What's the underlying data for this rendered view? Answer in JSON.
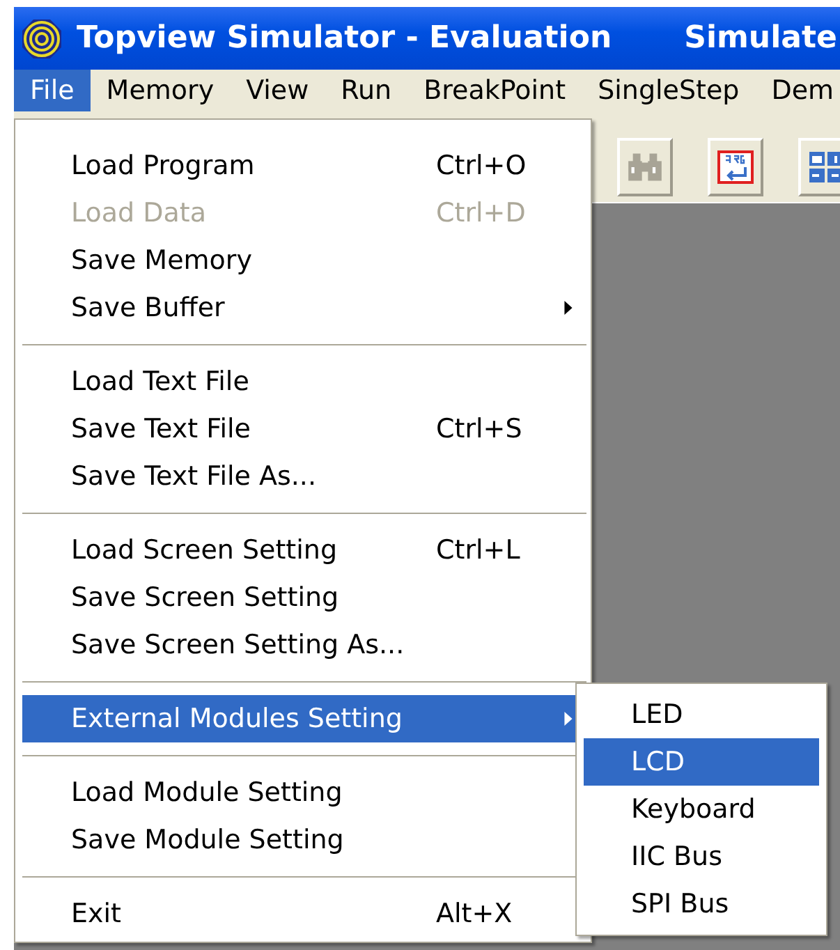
{
  "window": {
    "title": "Topview Simulator - Evaluation",
    "title_2": "Simulate"
  },
  "menubar": [
    {
      "label": "File",
      "selected": true
    },
    {
      "label": "Memory",
      "selected": false
    },
    {
      "label": "View",
      "selected": false
    },
    {
      "label": "Run",
      "selected": false
    },
    {
      "label": "BreakPoint",
      "selected": false
    },
    {
      "label": "SingleStep",
      "selected": false
    },
    {
      "label": "Dem",
      "selected": false
    }
  ],
  "toolbar": [
    {
      "kind": "find"
    },
    {
      "kind": "program"
    },
    {
      "kind": "layout"
    }
  ],
  "file_menu": [
    {
      "kind": "item",
      "label": "Load Program",
      "shortcut": "Ctrl+O",
      "disabled": false,
      "selected": false,
      "has_submenu": false
    },
    {
      "kind": "item",
      "label": "Load Data",
      "shortcut": "Ctrl+D",
      "disabled": true,
      "selected": false,
      "has_submenu": false
    },
    {
      "kind": "item",
      "label": "Save Memory",
      "disabled": false,
      "selected": false,
      "has_submenu": false
    },
    {
      "kind": "item",
      "label": "Save Buffer",
      "disabled": false,
      "selected": false,
      "has_submenu": true
    },
    {
      "kind": "separator"
    },
    {
      "kind": "item",
      "label": "Load Text File",
      "disabled": false,
      "selected": false,
      "has_submenu": false
    },
    {
      "kind": "item",
      "label": "Save Text File",
      "shortcut": "Ctrl+S",
      "disabled": false,
      "selected": false,
      "has_submenu": false
    },
    {
      "kind": "item",
      "label": "Save Text File As...",
      "disabled": false,
      "selected": false,
      "has_submenu": false
    },
    {
      "kind": "separator"
    },
    {
      "kind": "item",
      "label": "Load Screen Setting",
      "shortcut": "Ctrl+L",
      "disabled": false,
      "selected": false,
      "has_submenu": false
    },
    {
      "kind": "item",
      "label": "Save Screen Setting",
      "disabled": false,
      "selected": false,
      "has_submenu": false
    },
    {
      "kind": "item",
      "label": "Save Screen Setting As...",
      "disabled": false,
      "selected": false,
      "has_submenu": false
    },
    {
      "kind": "separator"
    },
    {
      "kind": "item",
      "label": "External Modules Setting",
      "disabled": false,
      "selected": true,
      "has_submenu": true
    },
    {
      "kind": "separator"
    },
    {
      "kind": "item",
      "label": "Load Module Setting",
      "disabled": false,
      "selected": false,
      "has_submenu": false
    },
    {
      "kind": "item",
      "label": "Save Module Setting",
      "disabled": false,
      "selected": false,
      "has_submenu": false
    },
    {
      "kind": "separator"
    },
    {
      "kind": "item",
      "label": "Exit",
      "shortcut": "Alt+X",
      "disabled": false,
      "selected": false,
      "has_submenu": false
    }
  ],
  "submenu": [
    {
      "label": "LED",
      "selected": false
    },
    {
      "label": "LCD",
      "selected": true
    },
    {
      "label": "Keyboard",
      "selected": false
    },
    {
      "label": "IIC Bus",
      "selected": false
    },
    {
      "label": "SPI Bus",
      "selected": false
    }
  ]
}
